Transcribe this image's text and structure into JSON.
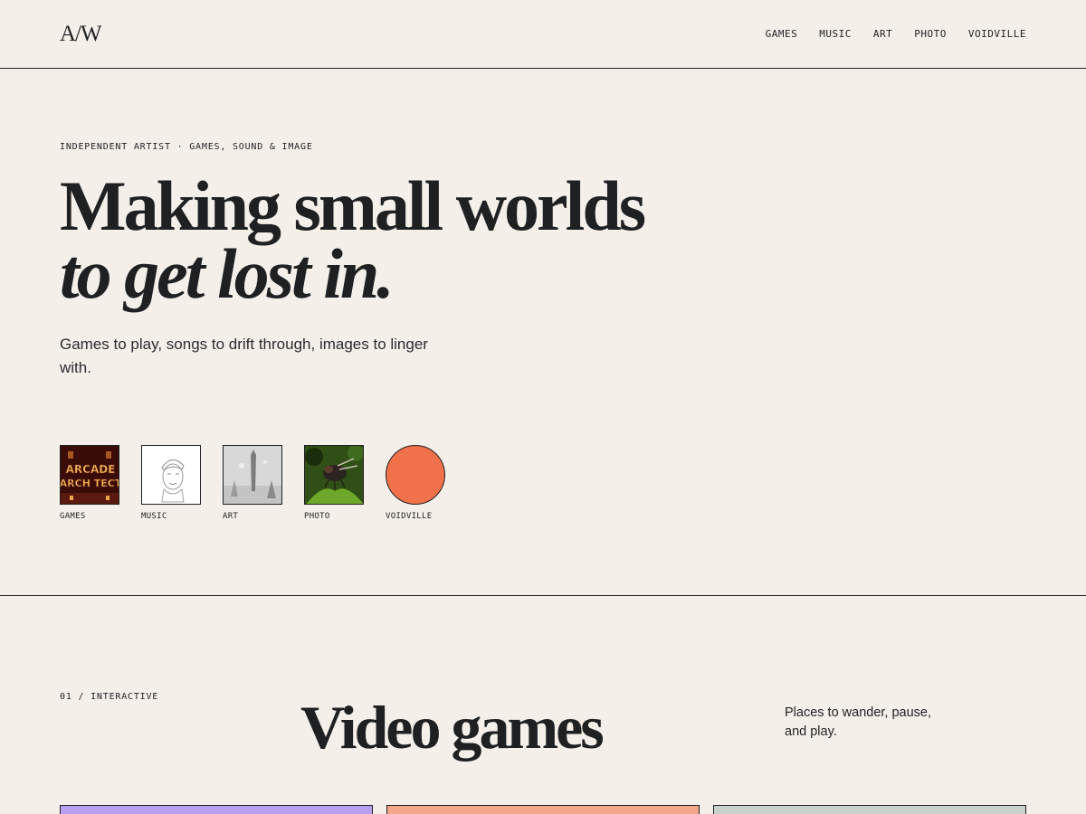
{
  "header": {
    "logo": "A/W",
    "nav": [
      "GAMES",
      "MUSIC",
      "ART",
      "PHOTO",
      "VOIDVILLE"
    ]
  },
  "hero": {
    "eyebrow": "INDEPENDENT ARTIST · GAMES, SOUND & IMAGE",
    "headline_line1": "Making small worlds",
    "headline_line2": "to get lost in.",
    "lede": "Games to play, songs to drift through, images to linger with."
  },
  "tiles": [
    {
      "label": "GAMES",
      "thumb_text_1": "ARCADE",
      "thumb_text_2": "ARCH TECT"
    },
    {
      "label": "MUSIC"
    },
    {
      "label": "ART"
    },
    {
      "label": "PHOTO"
    },
    {
      "label": "VOIDVILLE",
      "color": "#f1714a"
    }
  ],
  "section_games": {
    "eyebrow": "01 / INTERACTIVE",
    "title": "Video games",
    "description": "Places to wander, pause, and play."
  },
  "cards": [
    {
      "color": "#b99ff0"
    },
    {
      "color": "#f4a78b"
    },
    {
      "color": "#c7d3cc"
    }
  ]
}
